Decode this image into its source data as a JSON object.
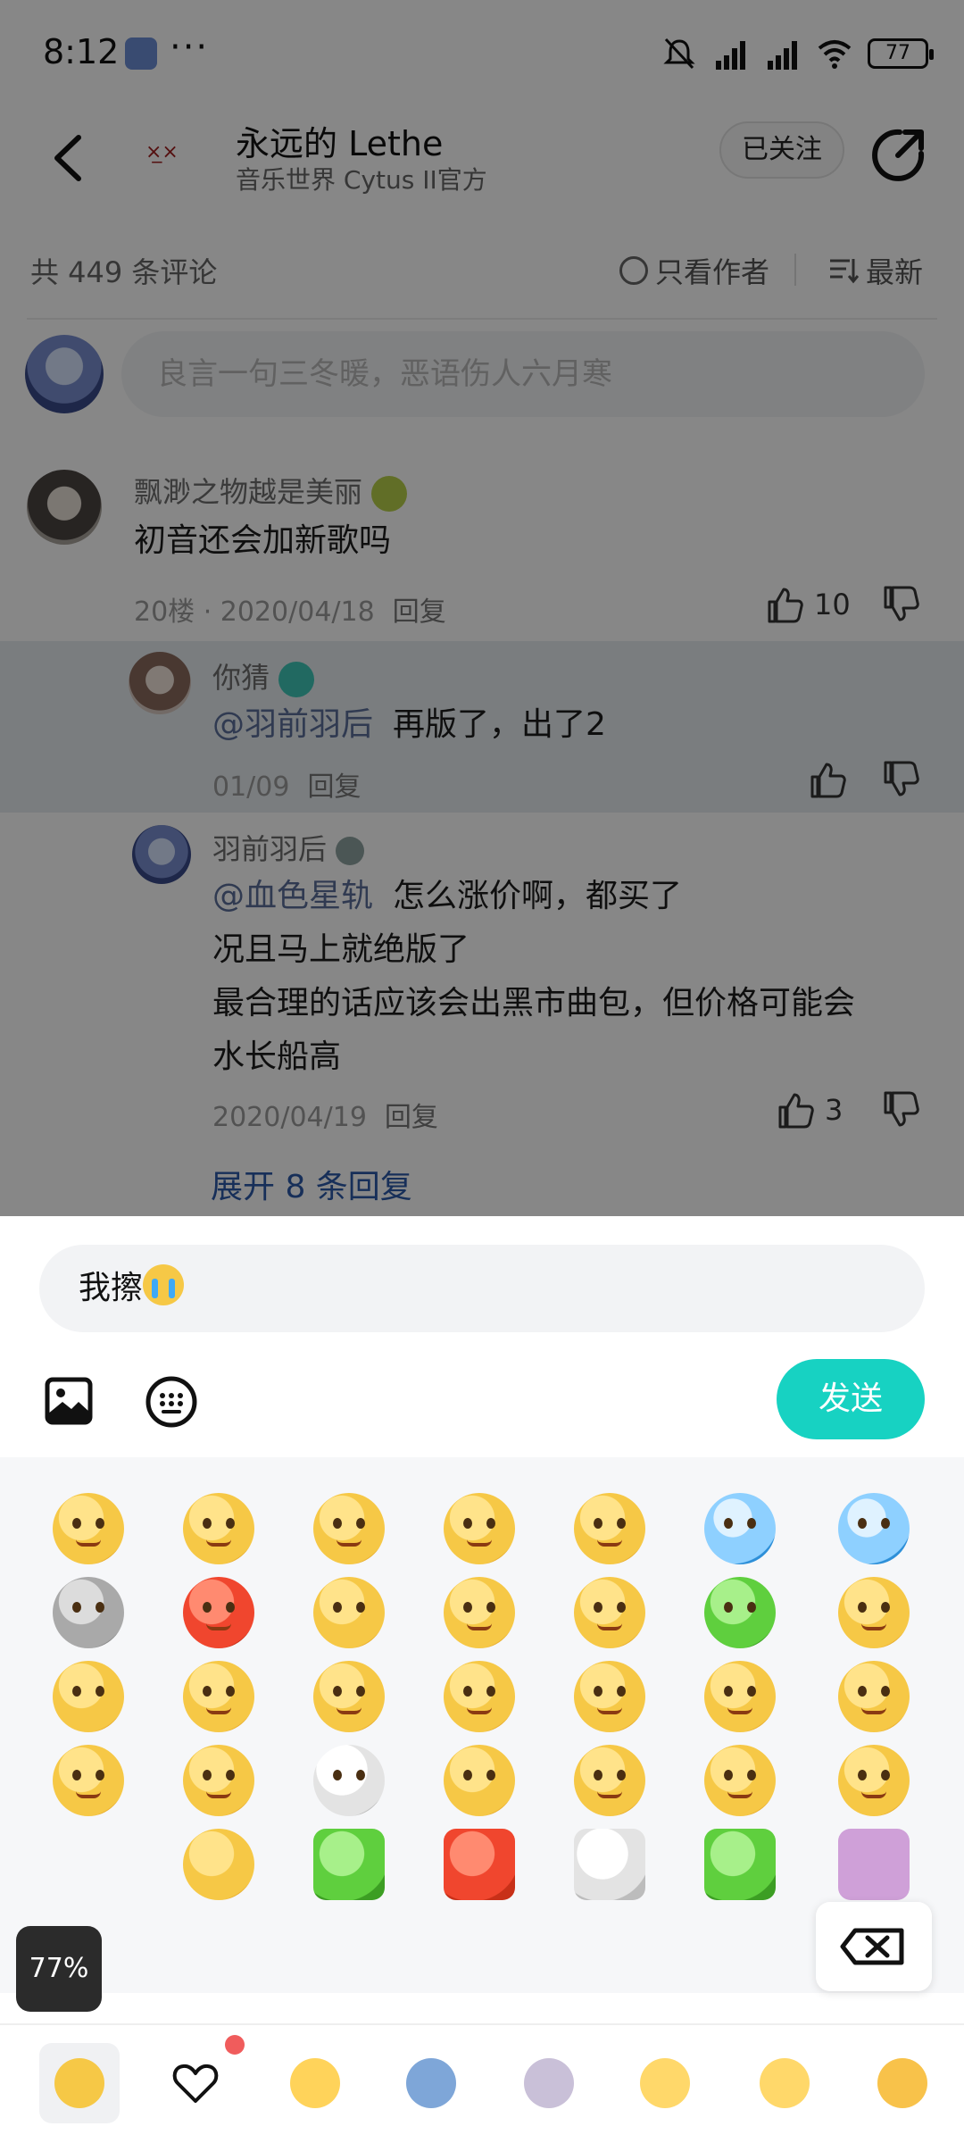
{
  "status_bar": {
    "time": "8:12",
    "more": "···",
    "battery": "77"
  },
  "header": {
    "title": "永远的  Lethe",
    "subtitle": "音乐世界 Cytus II官方",
    "follow_label": "已关注"
  },
  "toolbar": {
    "count_text": "共 449 条评论",
    "author_only_label": "只看作者",
    "sort_label": "最新"
  },
  "compose": {
    "placeholder": "良言一句三冬暖，恶语伤人六月寒"
  },
  "comments": [
    {
      "name": "飘渺之物越是美丽",
      "text": "初音还会加新歌吗",
      "floor_date": "20楼 · 2020/04/18",
      "reply_label": "回复",
      "likes": "10"
    },
    {
      "name": "你猜",
      "mention": "@羽前羽后",
      "text": "再版了，出了2",
      "date": "01/09",
      "reply_label": "回复",
      "likes": ""
    },
    {
      "name": "羽前羽后",
      "mention": "@血色星轨",
      "text_line1": "怎么涨价啊，都买了",
      "text_line2": "况且马上就绝版了",
      "text_line3": "最合理的话应该会出黑市曲包，但价格可能会",
      "text_line4": "水长船高",
      "date": "2020/04/19",
      "reply_label": "回复",
      "likes": "3"
    }
  ],
  "expand_label": "展开 8 条回复",
  "reply_box": {
    "value": "我擦"
  },
  "send_label": "发送",
  "overlay_percent": "77%",
  "colors": {
    "accent": "#17d2c2",
    "link": "#2c5aa8",
    "badge_red": "#f05c5c"
  },
  "icons": {
    "back": "arrow-left-icon",
    "share": "share-icon",
    "image": "image-icon",
    "keyboard": "keyboard-icon",
    "delete": "backspace-icon",
    "like": "thumb-up-icon",
    "dislike": "thumb-down-icon"
  }
}
